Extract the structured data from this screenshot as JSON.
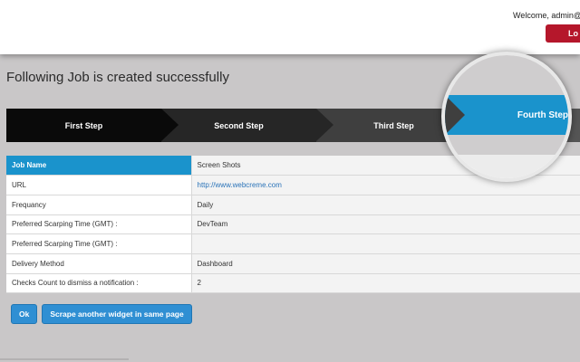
{
  "header": {
    "welcome_text": "Welcome, admin@d",
    "logout_label": "Lo"
  },
  "page": {
    "title": "Following Job is created successfully"
  },
  "steps": [
    {
      "label": "First Step"
    },
    {
      "label": "Second Step"
    },
    {
      "label": "Third Step"
    },
    {
      "label": "Fourth Step"
    }
  ],
  "job_table": {
    "rows": [
      {
        "label": "Job Name",
        "value": "Screen Shots"
      },
      {
        "label": "URL",
        "value": "http://www.webcreme.com"
      },
      {
        "label": "Frequancy",
        "value": "Daily"
      },
      {
        "label": "Preferred Scarping Time (GMT) :",
        "value": "DevTeam"
      },
      {
        "label": "Preferred Scarping Time (GMT) :",
        "value": ""
      },
      {
        "label": "Delivery Method",
        "value": "Dashboard"
      },
      {
        "label": "Checks Count to dismiss a notification :",
        "value": "2"
      }
    ]
  },
  "actions": {
    "ok_label": "Ok",
    "scrape_again_label": "Scrape another widget in same page"
  },
  "colors": {
    "accent_blue": "#1a93cc",
    "logout_red": "#b5172b",
    "button_blue": "#2f8fd3"
  }
}
